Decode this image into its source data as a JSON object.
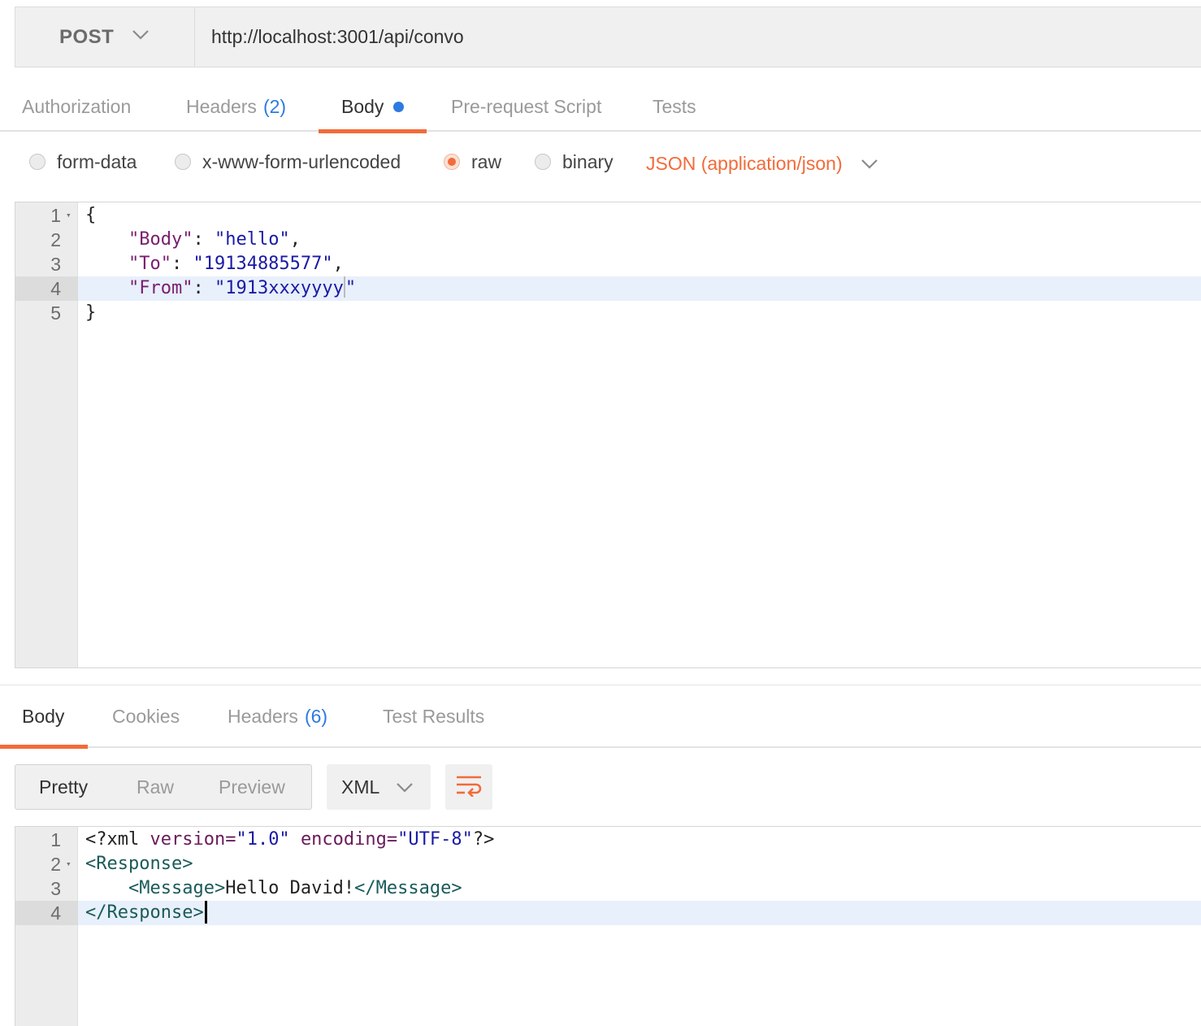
{
  "request": {
    "method": "POST",
    "url": "http://localhost:3001/api/convo",
    "tabs": [
      {
        "label": "Authorization",
        "count": ""
      },
      {
        "label": "Headers",
        "count": "(2)"
      },
      {
        "label": "Body",
        "count": ""
      },
      {
        "label": "Pre-request Script",
        "count": ""
      },
      {
        "label": "Tests",
        "count": ""
      }
    ],
    "active_tab": "Body",
    "body_types": [
      "form-data",
      "x-www-form-urlencoded",
      "raw",
      "binary"
    ],
    "selected_body_type": "raw",
    "content_type": "JSON (application/json)",
    "editor": {
      "line_numbers": [
        "1",
        "2",
        "3",
        "4",
        "5"
      ],
      "lines": {
        "l1": "{",
        "l2_key": "\"Body\"",
        "l2_val": "\"hello\"",
        "l3_key": "\"To\"",
        "l3_val": "\"19134885577\"",
        "l4_key": "\"From\"",
        "l4_val": "\"1913xxxyyyy",
        "l4_val_end": "\"",
        "l5": "}"
      }
    }
  },
  "response": {
    "tabs": [
      {
        "label": "Body",
        "count": ""
      },
      {
        "label": "Cookies",
        "count": ""
      },
      {
        "label": "Headers",
        "count": "(6)"
      },
      {
        "label": "Test Results",
        "count": ""
      }
    ],
    "active_tab": "Body",
    "view_modes": [
      "Pretty",
      "Raw",
      "Preview"
    ],
    "active_view_mode": "Pretty",
    "language": "XML",
    "editor": {
      "line_numbers": [
        "1",
        "2",
        "3",
        "4"
      ],
      "lines": {
        "l1_open": "<?xml",
        "l1_attr1": "version=",
        "l1_val1": "\"1.0\"",
        "l1_attr2": "encoding=",
        "l1_val2": "\"UTF-8\"",
        "l1_close": "?>",
        "l2": "<Response>",
        "l3_open": "<Message>",
        "l3_text": "Hello David!",
        "l3_close": "</Message>",
        "l4": "</Response>"
      }
    }
  },
  "colors": {
    "accent": "#f26b3a",
    "link_blue": "#2d7ae0"
  },
  "icons": [
    "chevron-down-icon",
    "text-wrap-icon",
    "fold-arrow-icon"
  ]
}
